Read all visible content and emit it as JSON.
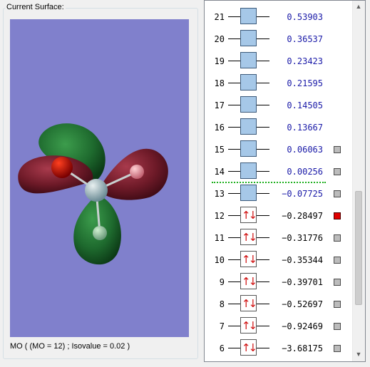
{
  "surface_panel": {
    "title": "Current Surface:",
    "caption": "MO ( (MO = 12) ; Isovalue = 0.02 )",
    "background_color": "#8080cc"
  },
  "mo_list": {
    "rows": [
      {
        "num": "21",
        "energy": "0.53903",
        "occupied": false,
        "checkbox": false
      },
      {
        "num": "20",
        "energy": "0.36537",
        "occupied": false,
        "checkbox": false
      },
      {
        "num": "19",
        "energy": "0.23423",
        "occupied": false,
        "checkbox": false
      },
      {
        "num": "18",
        "energy": "0.21595",
        "occupied": false,
        "checkbox": false
      },
      {
        "num": "17",
        "energy": "0.14505",
        "occupied": false,
        "checkbox": false
      },
      {
        "num": "16",
        "energy": "0.13667",
        "occupied": false,
        "checkbox": false
      },
      {
        "num": "15",
        "energy": "0.06063",
        "occupied": false,
        "checkbox": true,
        "selected": false
      },
      {
        "num": "14",
        "energy": "0.00256",
        "occupied": false,
        "checkbox": true,
        "selected": false
      },
      {
        "num": "13",
        "energy": "−0.07725",
        "occupied": false,
        "checkbox": true,
        "selected": false
      },
      {
        "num": "12",
        "energy": "−0.28497",
        "occupied": true,
        "checkbox": true,
        "selected": true
      },
      {
        "num": "11",
        "energy": "−0.31776",
        "occupied": true,
        "checkbox": true,
        "selected": false
      },
      {
        "num": "10",
        "energy": "−0.35344",
        "occupied": true,
        "checkbox": true,
        "selected": false
      },
      {
        "num": "9",
        "energy": "−0.39701",
        "occupied": true,
        "checkbox": true,
        "selected": false
      },
      {
        "num": "8",
        "energy": "−0.52697",
        "occupied": true,
        "checkbox": true,
        "selected": false
      },
      {
        "num": "7",
        "energy": "−0.92469",
        "occupied": true,
        "checkbox": true,
        "selected": false
      },
      {
        "num": "6",
        "energy": "−3.68175",
        "occupied": true,
        "checkbox": true,
        "selected": false
      }
    ],
    "electron_pair_glyph": "↑↓",
    "colors": {
      "virtual_energy": "#1a1aa8",
      "occupied_energy": "#000000",
      "selected_checkbox": "#e00000",
      "homo_lumo_divider": "#20b020"
    }
  },
  "scrollbar": {
    "up_glyph": "▲",
    "down_glyph": "▼"
  }
}
